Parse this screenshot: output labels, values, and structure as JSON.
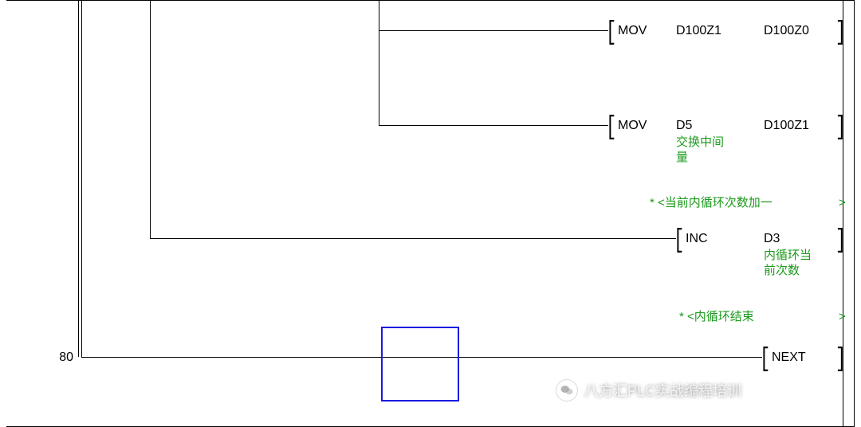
{
  "rung1": {
    "op": "MOV",
    "src": "D100Z1",
    "dst": "D100Z0"
  },
  "rung2": {
    "op": "MOV",
    "src": "D5",
    "dst": "D100Z1",
    "src_comment": "交换中间\n量"
  },
  "comment_inc": "* <当前内循环次数加一",
  "rung3": {
    "op": "INC",
    "dst": "D3",
    "dst_comment": "内循环当\n前次数"
  },
  "comment_next": "* <内循环结束",
  "rung4": {
    "op": "NEXT"
  },
  "step4": "80",
  "comment_tail": ">",
  "watermark": "八方汇PLC实战编程培训"
}
